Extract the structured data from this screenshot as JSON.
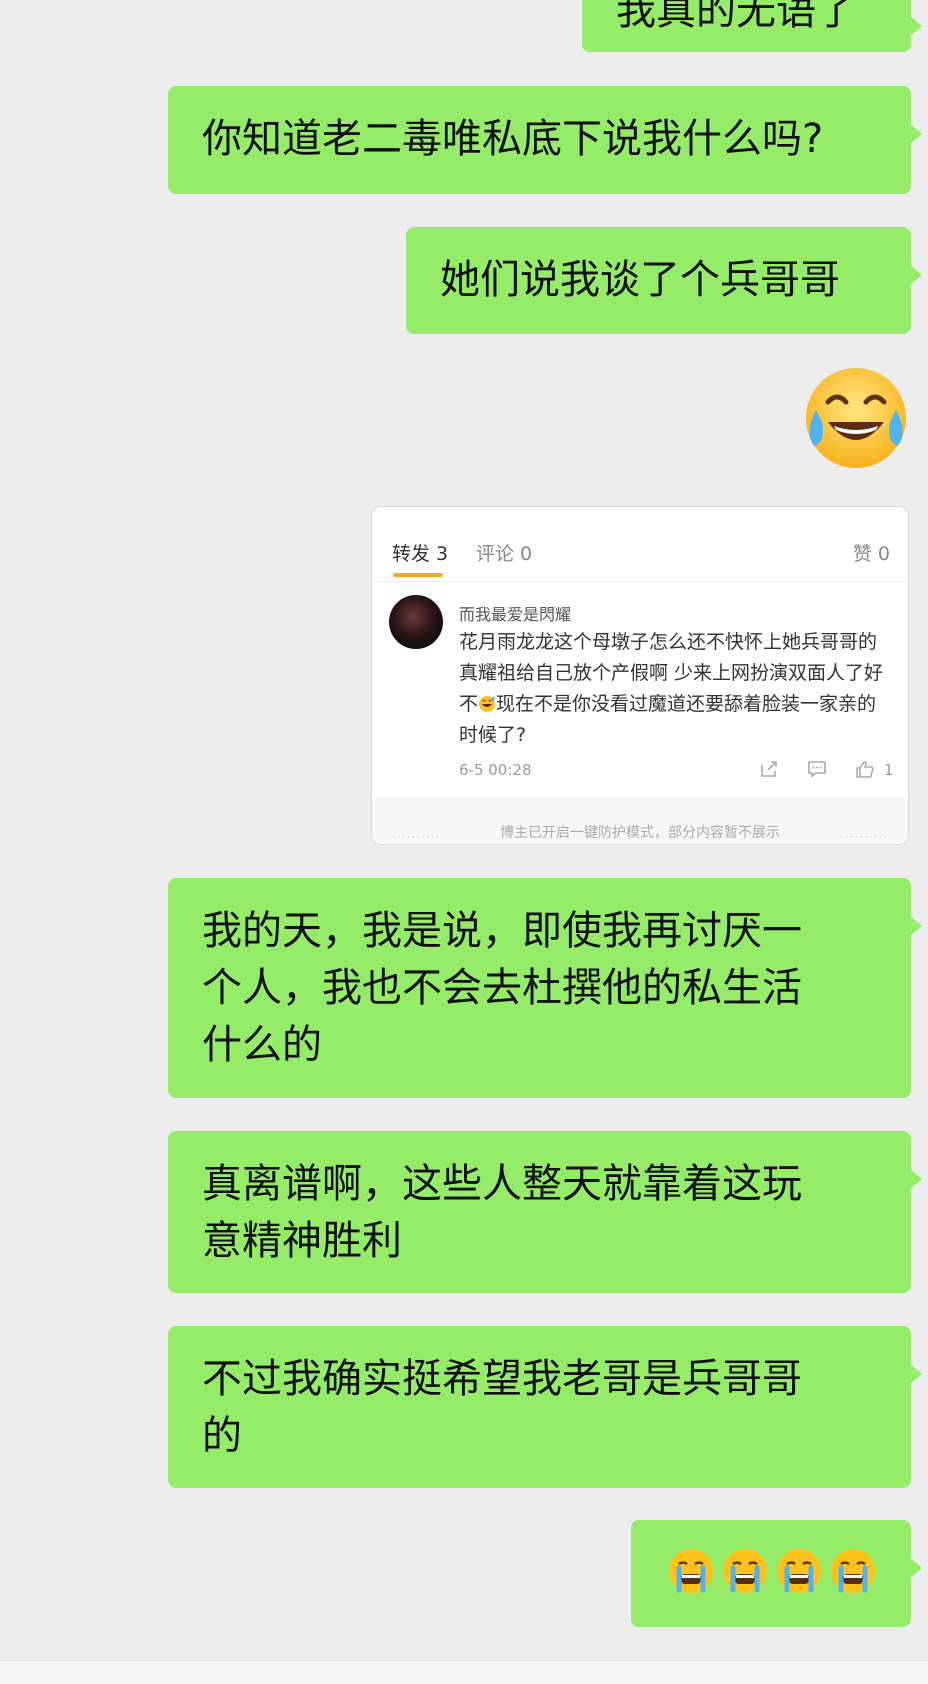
{
  "messages": [
    {
      "text": "我真的无语了"
    },
    {
      "text": "你知道老二毒唯私底下说我什么吗?"
    },
    {
      "text": "她们说我谈了个兵哥哥"
    },
    {
      "emoji": "joy-tears-emoji"
    },
    {
      "text": "我的天，我是说，即使我再讨厌一\n个人，我也不会去杜撰他的私生活\n什么的"
    },
    {
      "text": "真离谱啊，这些人整天就靠着这玩\n意精神胜利"
    },
    {
      "text": "不过我确实挺希望我老哥是兵哥哥\n的"
    },
    {
      "emoji": "crying-emoji x4"
    }
  ],
  "card": {
    "tab_repost": "转发 3",
    "tab_comment": "评论 0",
    "tab_like": "赞 0",
    "username": "而我最爱是閃耀",
    "comment_part1": "花月雨龙龙这个母墩子怎么还不快怀上她兵哥哥的真耀祖给自己放个产假啊 少来上网扮演双面人了好不",
    "comment_part2": "现在不是你没看过魔道还要舔着脸装一家亲的时候了?",
    "time": "6-5 00:28",
    "like_count": "1",
    "footer_note": "博主已开启一键防护模式，部分内容暂不展示",
    "footer_dots": "··········"
  },
  "colors": {
    "bubble": "#95ec69",
    "background": "#ededed",
    "accent": "#f5a623"
  }
}
